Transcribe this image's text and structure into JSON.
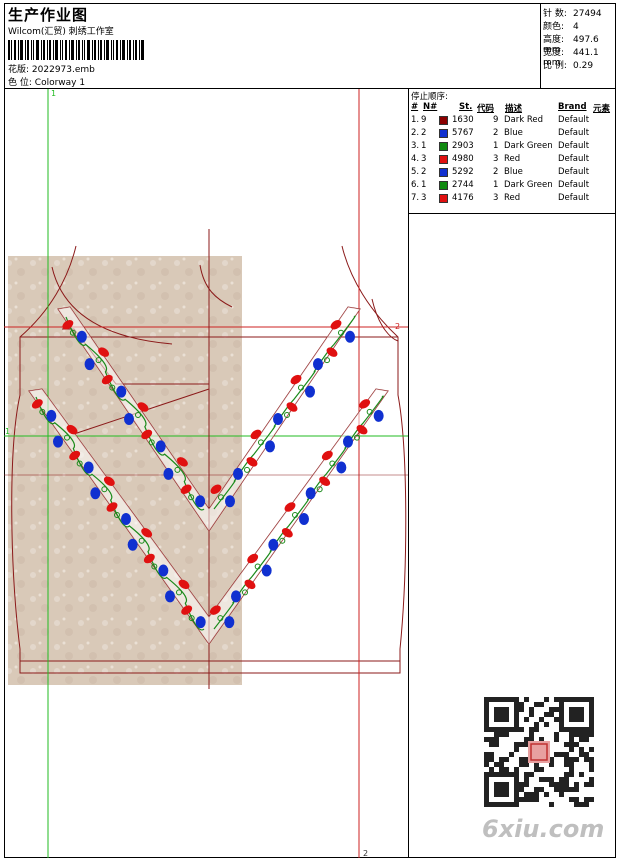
{
  "header": {
    "title": "生产作业图",
    "subtitle": "Wilcom(汇贸) 刺绣工作室",
    "design_label": "花版:",
    "design_value": "2022973.emb",
    "colorway_label": "色 位:",
    "colorway_value": "Colorway 1"
  },
  "stats": [
    {
      "label": "针 数:",
      "value": "27494"
    },
    {
      "label": "颜色:",
      "value": "4"
    },
    {
      "label": "高度:",
      "value": "497.6 mm"
    },
    {
      "label": "宽度:",
      "value": "441.1 mm"
    },
    {
      "label": "比 例:",
      "value": "0.29"
    }
  ],
  "stop_sequence": {
    "caption": "停止顺序:",
    "headers": {
      "num": "#",
      "n": "N#",
      "st": "St.",
      "code": "代码",
      "desc": "描述",
      "brand": "Brand",
      "element": "元素"
    },
    "rows": [
      {
        "num": "1.",
        "n": "9",
        "color": "#8b0000",
        "st": "1630",
        "code": "9",
        "desc": "Dark Red",
        "brand": "Default"
      },
      {
        "num": "2.",
        "n": "2",
        "color": "#1030d0",
        "st": "5767",
        "code": "2",
        "desc": "Blue",
        "brand": "Default"
      },
      {
        "num": "3.",
        "n": "1",
        "color": "#108a10",
        "st": "2903",
        "code": "1",
        "desc": "Dark Green",
        "brand": "Default"
      },
      {
        "num": "4.",
        "n": "3",
        "color": "#e01010",
        "st": "4980",
        "code": "3",
        "desc": "Red",
        "brand": "Default"
      },
      {
        "num": "5.",
        "n": "2",
        "color": "#1030d0",
        "st": "5292",
        "code": "2",
        "desc": "Blue",
        "brand": "Default"
      },
      {
        "num": "6.",
        "n": "1",
        "color": "#108a10",
        "st": "2744",
        "code": "1",
        "desc": "Dark Green",
        "brand": "Default"
      },
      {
        "num": "7.",
        "n": "3",
        "color": "#e01010",
        "st": "4176",
        "code": "3",
        "desc": "Red",
        "brand": "Default"
      }
    ]
  },
  "guides": {
    "v1": "1",
    "h2": "2",
    "h1": "1",
    "v2": "2"
  },
  "watermark": "6xiu.com",
  "colors": {
    "guide_green": "#22bb22",
    "guide_red": "#cc2222",
    "outline": "#8b1a1a",
    "fabric": "#d9c9b8"
  }
}
